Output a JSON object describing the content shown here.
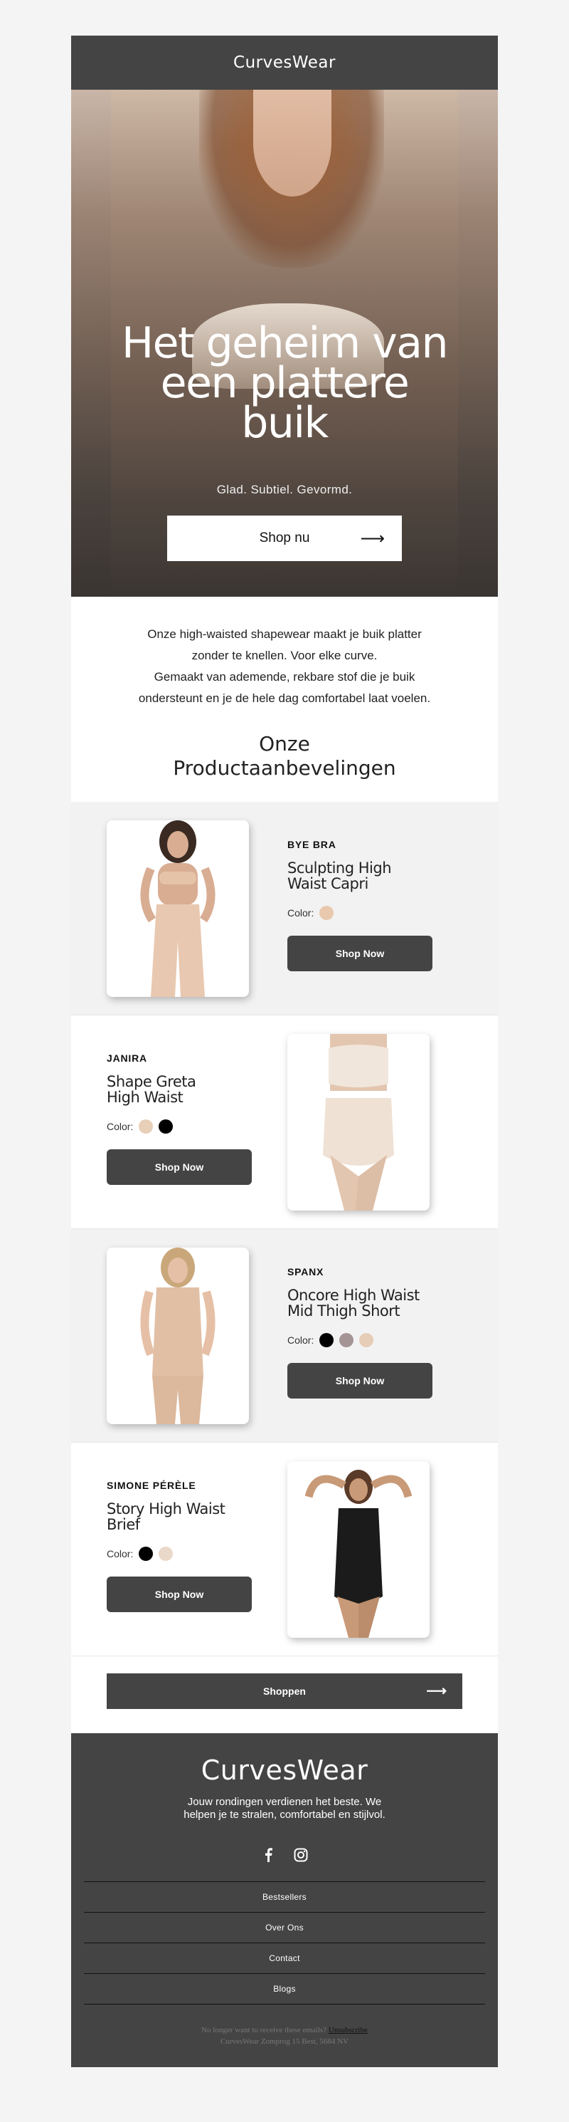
{
  "header": {
    "brand": "CurvesWear"
  },
  "hero": {
    "title_line1": "Het geheim van",
    "title_line2": "een plattere",
    "title_line3": "buik",
    "subtitle": "Glad. Subtiel. Gevormd.",
    "cta": "Shop nu"
  },
  "intro": {
    "line1": "Onze high-waisted shapewear maakt je buik platter",
    "line2": "zonder te knellen. Voor elke curve.",
    "line3": "Gemaakt van ademende, rekbare stof die je buik",
    "line4": "ondersteunt en je de hele dag comfortabel laat voelen."
  },
  "recommendations": {
    "title_line1": "Onze",
    "title_line2": "Productaanbevelingen"
  },
  "products": [
    {
      "brand": "BYE BRA",
      "name_line1": "Sculpting High",
      "name_line2": "Waist Capri",
      "color_label": "Color:",
      "colors": [
        "#e9c9ae"
      ],
      "cta": "Shop Now"
    },
    {
      "brand": "JANIRA",
      "name_line1": "Shape Greta",
      "name_line2": "High Waist",
      "color_label": "Color:",
      "colors": [
        "#e7cfb8",
        "#000000"
      ],
      "cta": "Shop Now"
    },
    {
      "brand": "SPANX",
      "name_line1": "Oncore High Waist",
      "name_line2": "Mid Thigh Short",
      "color_label": "Color:",
      "colors": [
        "#000000",
        "#a49594",
        "#e6cdb8"
      ],
      "cta": "Shop Now"
    },
    {
      "brand": "SIMONE PÉRÈLE",
      "name_line1": "Story High Waist",
      "name_line2": "Brief",
      "color_label": "Color:",
      "colors": [
        "#000000",
        "#ead8c9"
      ],
      "cta": "Shop Now"
    }
  ],
  "bottom_cta": "Shoppen",
  "footer": {
    "logo": "CurvesWear",
    "tagline": "Jouw rondingen verdienen het beste. We helpen je te stralen, comfortabel en stijlvol.",
    "nav": [
      "Bestsellers",
      "Over Ons",
      "Contact",
      "Blogs"
    ],
    "legal_text": "No longer want to receive these emails?",
    "unsubscribe": "Unsubscribe",
    "address": "CurvesWear Zomprog 15 Best, 5684 NV"
  }
}
